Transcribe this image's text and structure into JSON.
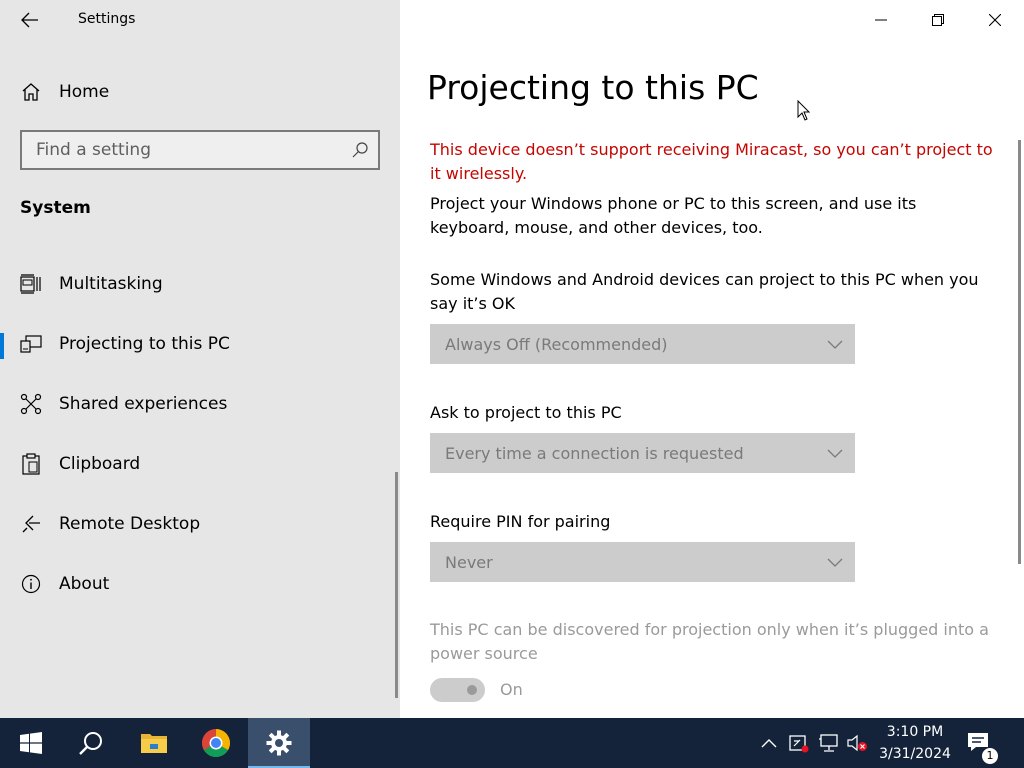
{
  "window": {
    "app_title": "Settings"
  },
  "sidebar": {
    "home_label": "Home",
    "search_placeholder": "Find a setting",
    "section_label": "System",
    "items": [
      {
        "label": "Multitasking",
        "icon": "multitasking-icon"
      },
      {
        "label": "Projecting to this PC",
        "icon": "projecting-icon",
        "selected": true
      },
      {
        "label": "Shared experiences",
        "icon": "shared-experiences-icon"
      },
      {
        "label": "Clipboard",
        "icon": "clipboard-icon"
      },
      {
        "label": "Remote Desktop",
        "icon": "remote-desktop-icon"
      },
      {
        "label": "About",
        "icon": "info-icon"
      }
    ]
  },
  "main": {
    "title": "Projecting to this PC",
    "warning": "This device doesn’t support receiving Miracast, so you can’t project to it wirelessly.",
    "description": "Project your Windows phone or PC to this screen, and use its keyboard, mouse, and other devices, too.",
    "settings": [
      {
        "label": "Some Windows and Android devices can project to this PC when you say it’s OK",
        "value": "Always Off (Recommended)"
      },
      {
        "label": "Ask to project to this PC",
        "value": "Every time a connection is requested"
      },
      {
        "label": "Require PIN for pairing",
        "value": "Never"
      }
    ],
    "power_note": "This PC can be discovered for projection only when it’s plugged into a power source",
    "toggle_label": "On",
    "toggle_value": true
  },
  "taskbar": {
    "time": "3:10 PM",
    "date": "3/31/2024",
    "notification_count": "1",
    "apps": [
      "start-icon",
      "search-icon",
      "file-explorer-icon",
      "chrome-icon",
      "settings-icon"
    ]
  },
  "colors": {
    "accent": "#0078d7",
    "warning": "#c50500",
    "sidebar_bg": "#e6e6e6",
    "taskbar_bg": "#14233a"
  }
}
